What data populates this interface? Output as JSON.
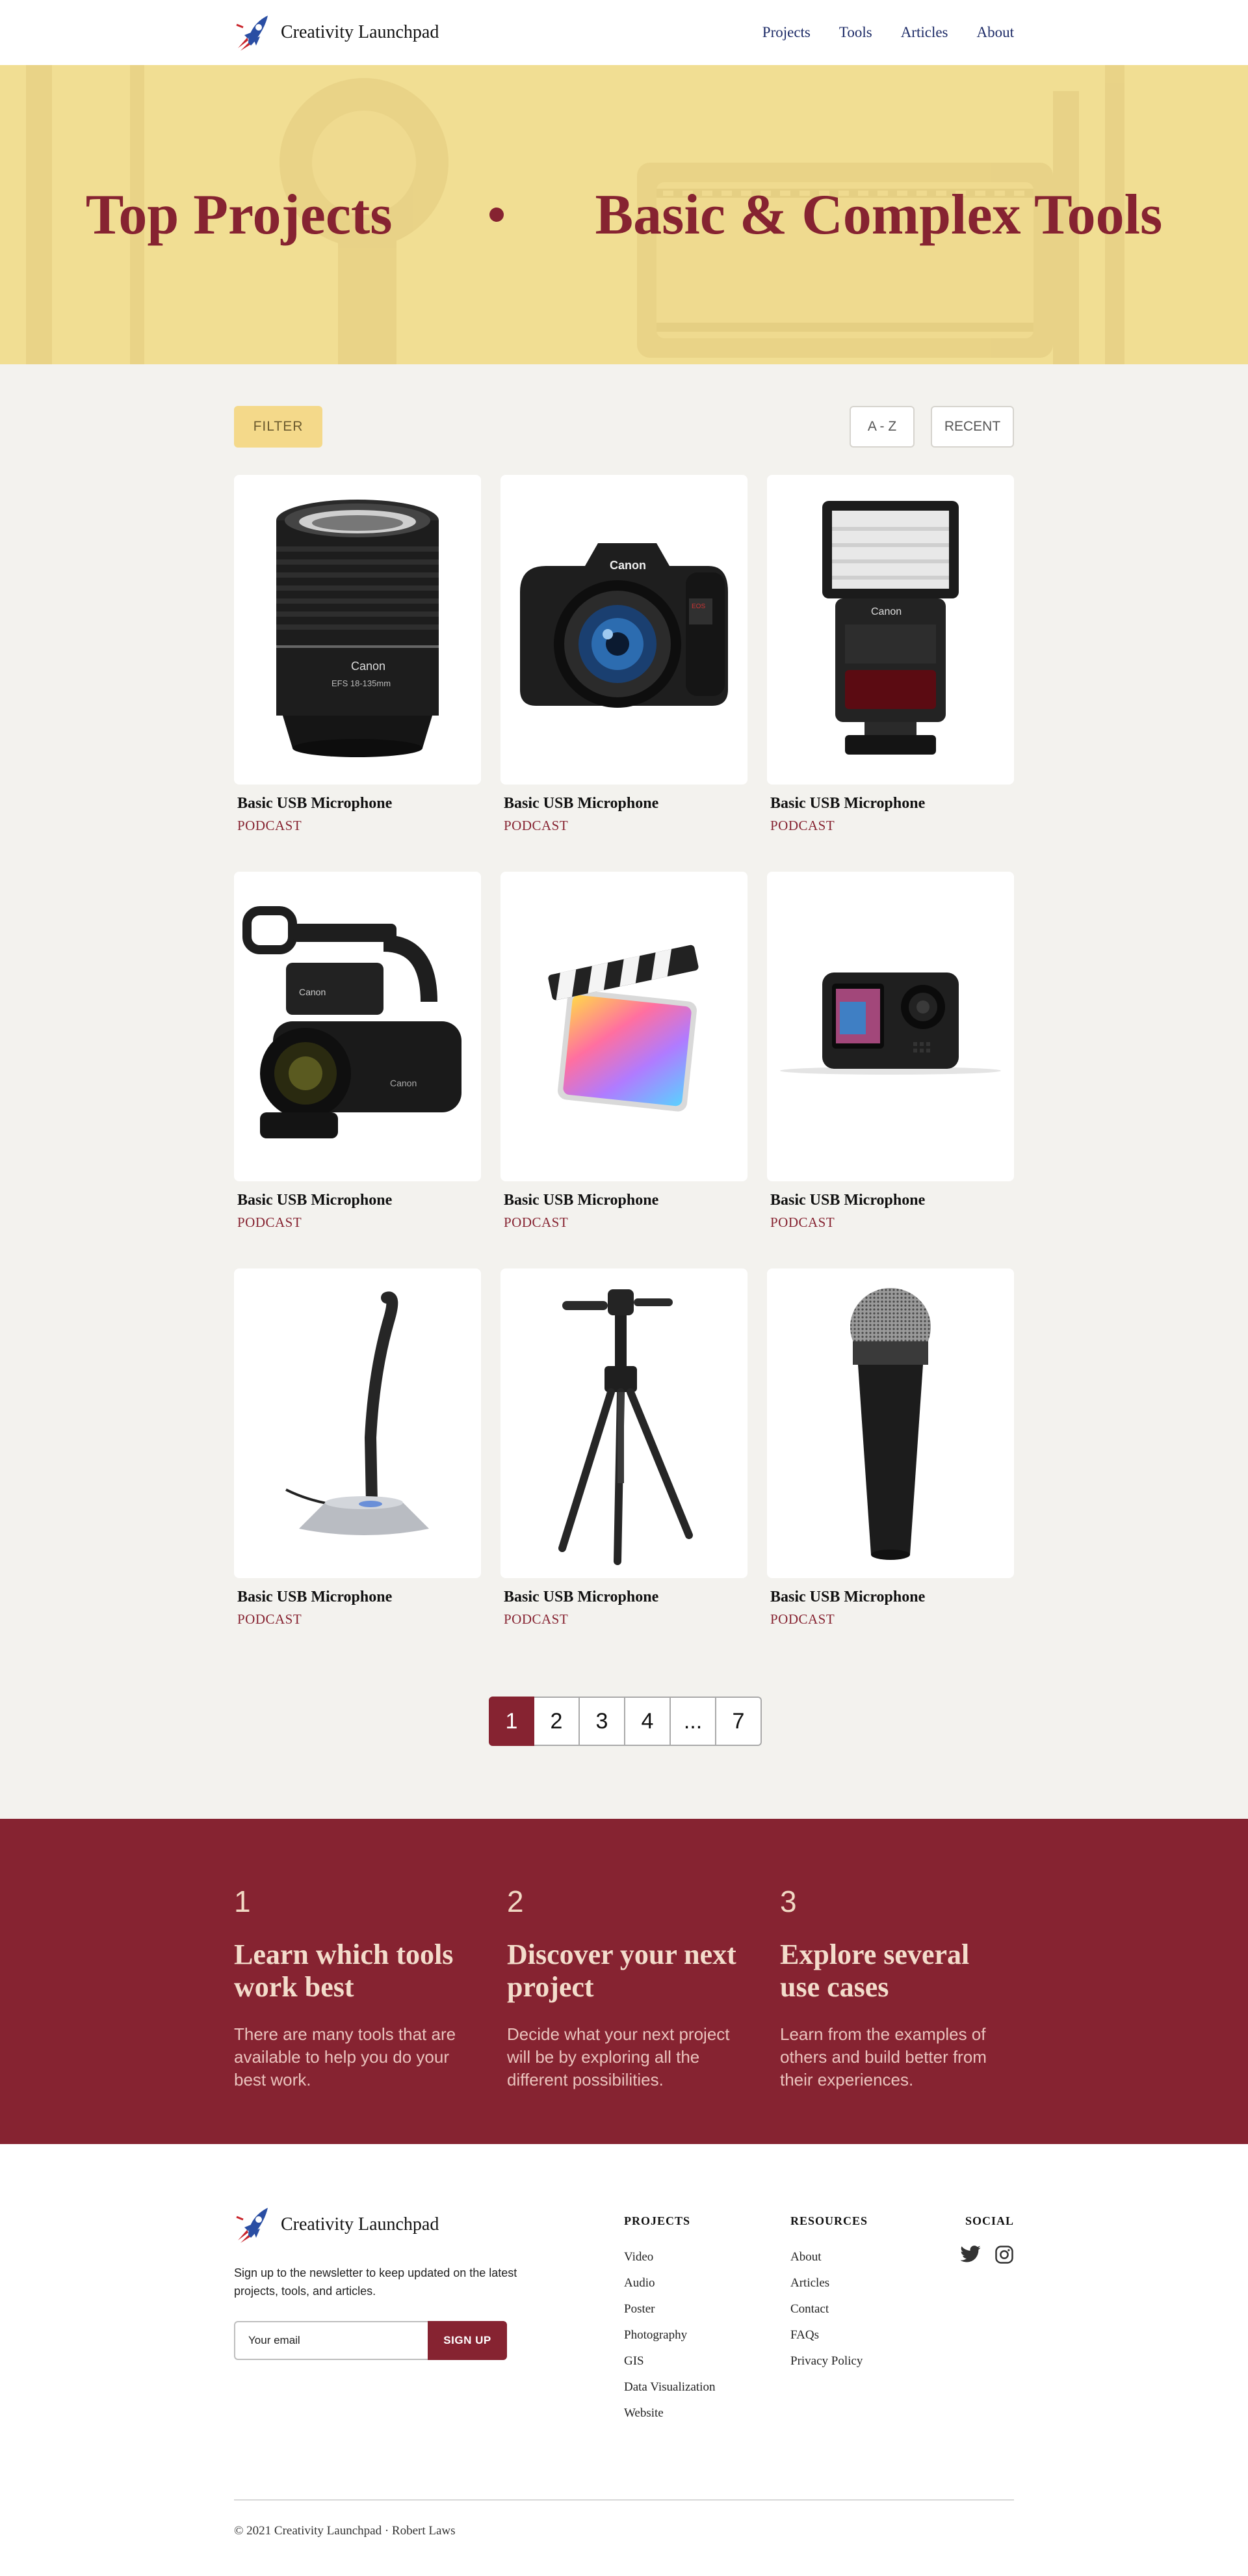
{
  "nav": {
    "brand": "Creativity Launchpad",
    "links": [
      "Projects",
      "Tools",
      "Articles",
      "About"
    ]
  },
  "hero": {
    "title_left": "Top Projects",
    "title_right": "Basic & Complex Tools"
  },
  "toolbar": {
    "filter_label": "FILTER",
    "az_label": "A - Z",
    "recent_label": "RECENT"
  },
  "cards": [
    {
      "title": "Basic USB Microphone",
      "tag": "PODCAST",
      "icon": "camera-lens-icon"
    },
    {
      "title": "Basic USB Microphone",
      "tag": "PODCAST",
      "icon": "dslr-camera-icon"
    },
    {
      "title": "Basic USB Microphone",
      "tag": "PODCAST",
      "icon": "camera-flash-icon"
    },
    {
      "title": "Basic USB Microphone",
      "tag": "PODCAST",
      "icon": "camcorder-icon"
    },
    {
      "title": "Basic USB Microphone",
      "tag": "PODCAST",
      "icon": "final-cut-pro-icon"
    },
    {
      "title": "Basic USB Microphone",
      "tag": "PODCAST",
      "icon": "action-camera-icon"
    },
    {
      "title": "Basic USB Microphone",
      "tag": "PODCAST",
      "icon": "gooseneck-microphone-icon"
    },
    {
      "title": "Basic USB Microphone",
      "tag": "PODCAST",
      "icon": "tripod-icon"
    },
    {
      "title": "Basic USB Microphone",
      "tag": "PODCAST",
      "icon": "handheld-microphone-icon"
    }
  ],
  "pagination": {
    "pages": [
      "1",
      "2",
      "3",
      "4",
      "...",
      "7"
    ],
    "current": "1"
  },
  "steps": [
    {
      "number": "1",
      "title": "Learn which tools work best",
      "text": "There are many tools that are available to help you do your best work."
    },
    {
      "number": "2",
      "title": "Discover your next project",
      "text": "Decide what your next project will be by exploring all the different possibilities."
    },
    {
      "number": "3",
      "title": "Explore several use cases",
      "text": "Learn from the examples of others and build better from their experiences."
    }
  ],
  "footer": {
    "brand": "Creativity Launchpad",
    "description": "Sign up to the newsletter to keep updated on the latest projects, tools, and articles.",
    "email_placeholder": "Your email",
    "signup_label": "SIGN UP",
    "projects_title": "PROJECTS",
    "projects": [
      "Video",
      "Audio",
      "Poster",
      "Photography",
      "GIS",
      "Data Visualization",
      "Website"
    ],
    "resources_title": "RESOURCES",
    "resources": [
      "About",
      "Articles",
      "Contact",
      "FAQs",
      "Privacy Policy"
    ],
    "social_title": "SOCIAL",
    "social_icons": [
      "twitter-icon",
      "instagram-icon"
    ],
    "copyright": "© 2021 Creativity Launchpad  ·  Robert Laws"
  },
  "colors": {
    "accent": "#862331",
    "hero_bg": "#f1de93",
    "filter_bg": "#f4d98a",
    "nav_link": "#1c2a66",
    "page_bg": "#f3f2ee"
  }
}
